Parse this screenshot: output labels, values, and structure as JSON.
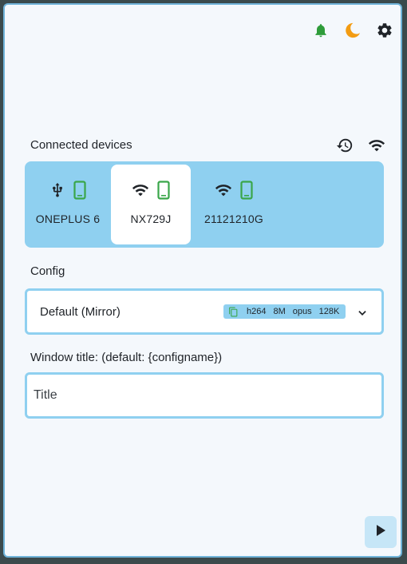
{
  "header": {
    "icons": [
      "bell-icon",
      "moon-icon",
      "gear-icon"
    ],
    "accent_colors": {
      "bell": "#2e9c3a",
      "moon": "#f39c12",
      "gear": "#1f2328"
    }
  },
  "devices_section": {
    "label": "Connected devices",
    "header_icons": [
      "history-icon",
      "wifi-icon"
    ],
    "devices": [
      {
        "name": "ONEPLUS 6",
        "connection": "usb",
        "selected": false
      },
      {
        "name": "NX729J",
        "connection": "wifi",
        "selected": true
      },
      {
        "name": "21121210G",
        "connection": "wifi",
        "selected": false
      }
    ],
    "panel_color": "#8fd0f0",
    "phone_color": "#3aa64a"
  },
  "config": {
    "label": "Config",
    "selected": "Default (Mirror)",
    "badge": {
      "video_codec": "h264",
      "video_bitrate": "8M",
      "audio_codec": "opus",
      "audio_bitrate": "128K"
    }
  },
  "window_title": {
    "label": "Window title: (default: {configname})",
    "placeholder": "Title",
    "value": ""
  },
  "actions": {
    "start_icon": "play-icon"
  }
}
